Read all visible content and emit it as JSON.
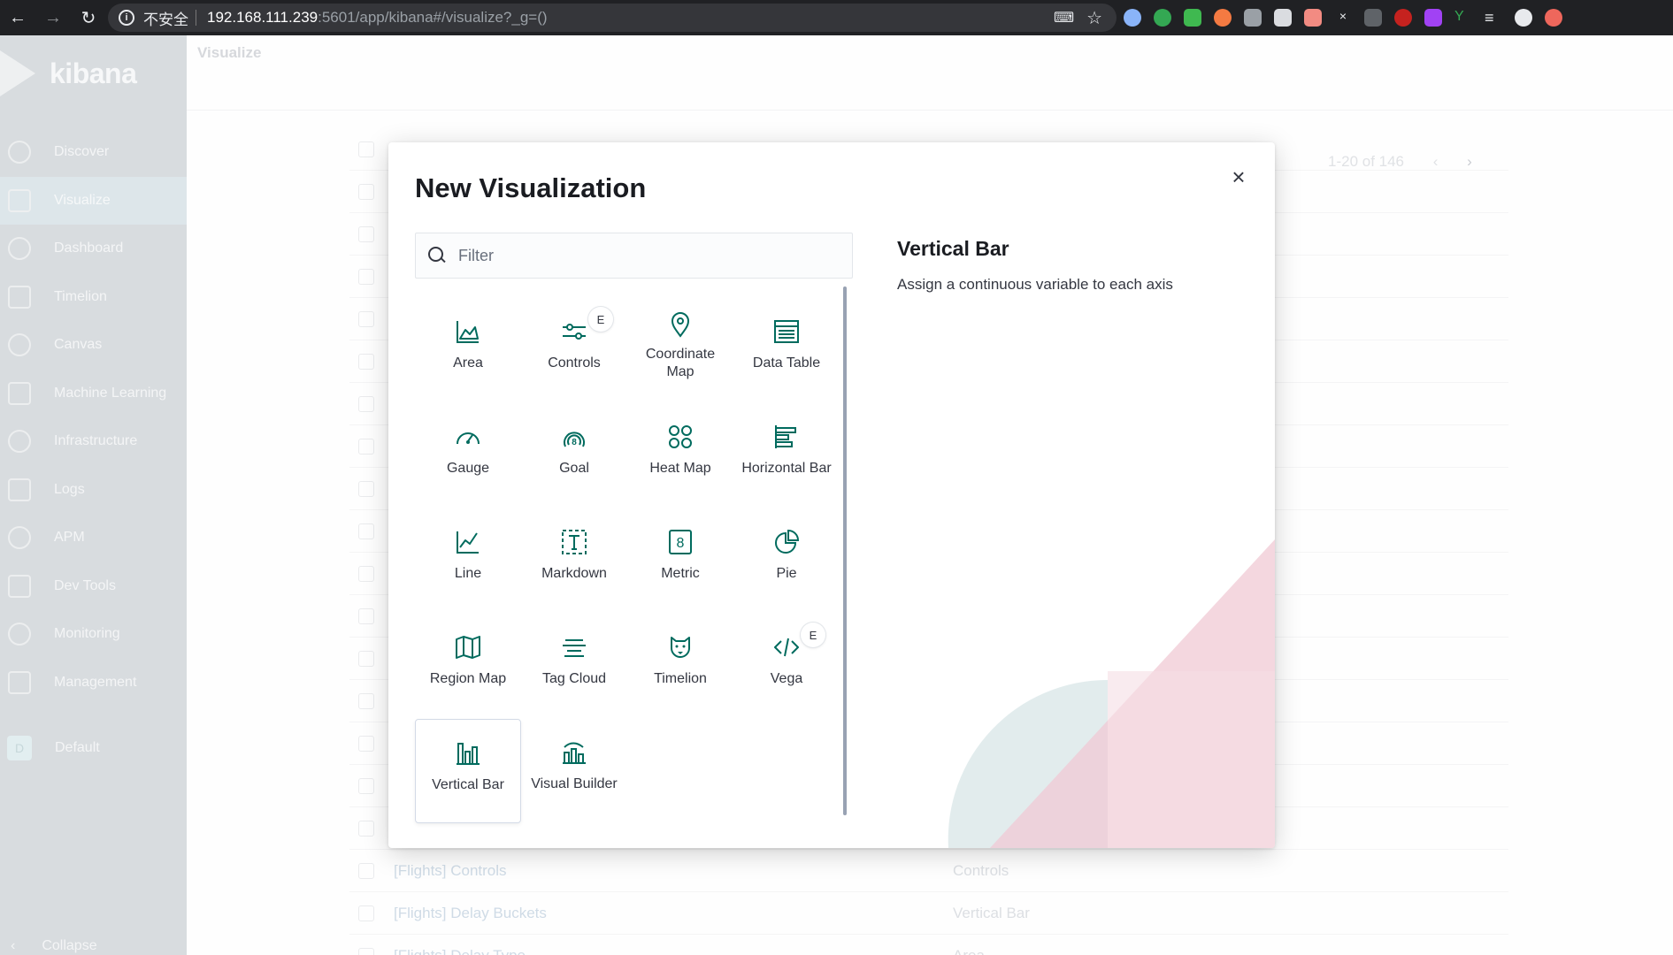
{
  "browser": {
    "insecure_label": "不安全",
    "url_host": "192.168.111.239",
    "url_rest": ":5601/app/kibana#/visualize?_g=()"
  },
  "sidebar": {
    "logo_text": "kibana",
    "items": [
      {
        "label": "Discover",
        "icon": "compass-icon"
      },
      {
        "label": "Visualize",
        "icon": "visualize-icon"
      },
      {
        "label": "Dashboard",
        "icon": "dashboard-icon"
      },
      {
        "label": "Timelion",
        "icon": "timelion-icon"
      },
      {
        "label": "Canvas",
        "icon": "canvas-icon"
      },
      {
        "label": "Machine Learning",
        "icon": "ml-icon"
      },
      {
        "label": "Infrastructure",
        "icon": "infrastructure-icon"
      },
      {
        "label": "Logs",
        "icon": "logs-icon"
      },
      {
        "label": "APM",
        "icon": "apm-icon"
      },
      {
        "label": "Dev Tools",
        "icon": "wrench-icon"
      },
      {
        "label": "Monitoring",
        "icon": "heartbeat-icon"
      },
      {
        "label": "Management",
        "icon": "gear-icon"
      }
    ],
    "space_badge": "D",
    "space_label": "Default",
    "collapse_label": "Collapse"
  },
  "main": {
    "breadcrumb": "Visualize",
    "pager": "1-20 of 146",
    "rows": [
      {
        "title": "[Flights] Controls",
        "type": "Controls"
      },
      {
        "title": "[Flights] Delay Buckets",
        "type": "Vertical Bar"
      },
      {
        "title": "[Flights] Delay Type",
        "type": "Area"
      }
    ]
  },
  "modal": {
    "title": "New Visualization",
    "filter_placeholder": "Filter",
    "close_icon": "×",
    "selected_title": "Vertical Bar",
    "selected_description": "Assign a continuous variable to each axis",
    "tiles": [
      {
        "label": "Area",
        "icon": "area-chart-icon"
      },
      {
        "label": "Controls",
        "icon": "controls-icon",
        "badge": "E"
      },
      {
        "label": "Coordinate Map",
        "icon": "map-pin-icon"
      },
      {
        "label": "Data Table",
        "icon": "table-icon"
      },
      {
        "label": "Gauge",
        "icon": "gauge-icon"
      },
      {
        "label": "Goal",
        "icon": "goal-icon"
      },
      {
        "label": "Heat Map",
        "icon": "heatmap-icon"
      },
      {
        "label": "Horizontal Bar",
        "icon": "horizontal-bar-icon"
      },
      {
        "label": "Line",
        "icon": "line-chart-icon"
      },
      {
        "label": "Markdown",
        "icon": "markdown-icon"
      },
      {
        "label": "Metric",
        "icon": "metric-icon",
        "metric_digit": "8"
      },
      {
        "label": "Pie",
        "icon": "pie-chart-icon"
      },
      {
        "label": "Region Map",
        "icon": "region-map-icon"
      },
      {
        "label": "Tag Cloud",
        "icon": "tag-cloud-icon"
      },
      {
        "label": "Timelion",
        "icon": "timelion-icon"
      },
      {
        "label": "Vega",
        "icon": "code-icon",
        "badge": "E"
      },
      {
        "label": "Vertical Bar",
        "icon": "vertical-bar-icon"
      },
      {
        "label": "Visual Builder",
        "icon": "visual-builder-icon"
      }
    ]
  },
  "colors": {
    "accent": "#006b5e",
    "deco_pink": "#f0c9d4",
    "deco_teal": "#d9e6e7"
  }
}
